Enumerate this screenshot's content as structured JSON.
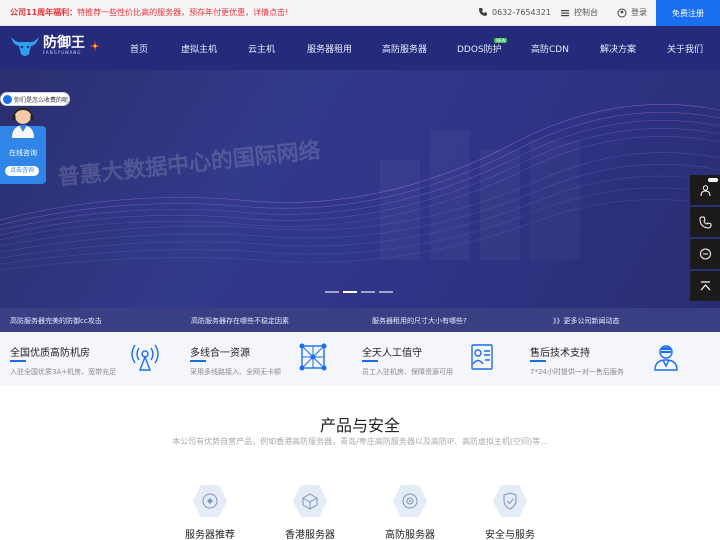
{
  "topbar": {
    "promo_prefix": "公司11周年福利：",
    "promo_text": "特推荐一些性价比高的服务器，预存年付更优惠，详情点击!",
    "phone": "0632-7654321",
    "console_label": "控制台",
    "login_label": "登录",
    "register_label": "免费注册"
  },
  "logo": {
    "name": "防御王",
    "sub": "FANGYUWANG"
  },
  "nav": {
    "items": [
      "首页",
      "虚拟主机",
      "云主机",
      "服务器租用",
      "高防服务器",
      "DDOS防护",
      "高防CDN",
      "解决方案",
      "关于我们"
    ],
    "badge": "NEW"
  },
  "hero": {
    "faded_text": "普惠大数据中心的国际网络"
  },
  "consult": {
    "question": "你们是怎么收费的呢",
    "label": "在线咨询",
    "button": "点击咨询"
  },
  "right_float": {
    "badge": "• • •"
  },
  "news": {
    "items": [
      "高防服务器完美的防御cc攻击",
      "高防服务器存在哪些不稳定因素",
      "服务器租用的尺寸大小有哪些?",
      "》》更多公司新闻动态"
    ]
  },
  "features": [
    {
      "title": "全国优质高防机房",
      "desc": "入驻全国优质3A+机房、宽带充足"
    },
    {
      "title": "多线合一资源",
      "desc": "采用多线路接入、全网无卡顿"
    },
    {
      "title": "全天人工值守",
      "desc": "员工入驻机房、保障资源可用"
    },
    {
      "title": "售后技术支持",
      "desc": "7*24小时提供一对一售后服务"
    }
  ],
  "products": {
    "title": "产品与安全",
    "subtitle": "本公司有优势自营产品，例如香港高防服务器，青岛/枣庄高防服务器以及高防IP、高防虚拟主机(空间)等...",
    "items": [
      "服务器推荐",
      "香港服务器",
      "高防服务器",
      "安全与服务"
    ]
  },
  "colors": {
    "accent": "#1a6ff0",
    "nav_bg": "#232b7a",
    "promo": "#e8333a",
    "news_bg": "#3a3f84"
  }
}
